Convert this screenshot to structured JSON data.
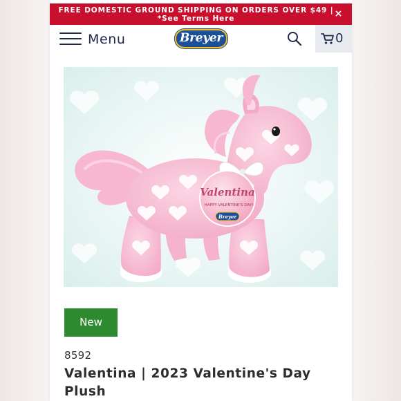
{
  "promo": {
    "line1": "FREE DOMESTIC GROUND SHIPPING ON ORDERS OVER $49 |",
    "line2": "*See Terms Here",
    "close_icon": "×"
  },
  "header": {
    "menu_label": "Menu",
    "logo_text": "Breyer",
    "cart_count": "0"
  },
  "product": {
    "image_tag": {
      "name": "Valentina",
      "greeting": "HAPPY VALENTINE'S DAY!",
      "brand": "Breyer"
    },
    "badge": "New",
    "sku": "8592",
    "title": "Valentina | 2023 Valentine's Day Plush"
  },
  "icons": [
    "hamburger-icon",
    "search-icon",
    "cart-icon",
    "close-icon"
  ],
  "colors": {
    "promo_bar": "#c8102e",
    "badge": "#2e8a2e",
    "brand_blue": "#1d4e9a",
    "brand_yellow": "#f2c21b",
    "plush_pink": "#f6bfd3"
  }
}
